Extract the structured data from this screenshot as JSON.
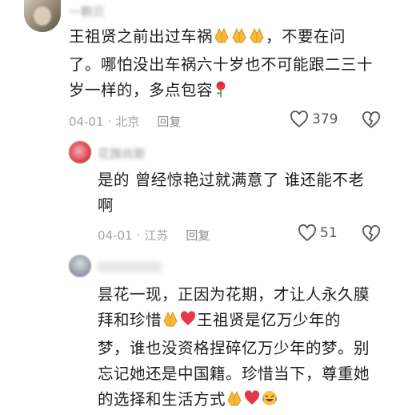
{
  "comments": [
    {
      "author": "一颗贝",
      "lines": [
        {
          "text": "王祖贤之前出过车祸",
          "emojis": [
            "pray",
            "pray",
            "pray"
          ],
          "after": "，不要在问"
        },
        {
          "text": "了。哪怕没出车祸六十岁也不可能跟二三十"
        },
        {
          "text": "岁一样的，多点包容",
          "emojis": [
            "rose"
          ]
        }
      ],
      "date": "04-01",
      "location": "北京",
      "reply_label": "回复",
      "likes": "379"
    },
    {
      "author": "花旗尚斯",
      "lines": [
        {
          "text": "是的 曾经惊艳过就满意了 谁还能不老"
        },
        {
          "text": "啊"
        }
      ],
      "date": "04-01",
      "location": "江苏",
      "reply_label": "回复",
      "likes": "51"
    },
    {
      "author": "",
      "lines": [
        {
          "text": "昙花一现，正因为花期，才让人永久膜"
        },
        {
          "text": "拜和珍惜",
          "emojis_mid": [
            "pray",
            "heart"
          ],
          "after": "王祖贤是亿万少年的"
        },
        {
          "text": "梦，谁也没资格捏碎亿万少年的梦。别"
        },
        {
          "text": "忘记她还是中国籍。珍惜当下，尊重她"
        },
        {
          "text": "的选择和生活方式",
          "emojis": [
            "pray",
            "heart",
            "laugh"
          ]
        }
      ]
    }
  ],
  "separator": "·",
  "colors": {
    "text": "#1e1e1e",
    "meta": "#a3a3a3",
    "heart": "#e8374a",
    "pray": "#f5b935"
  }
}
